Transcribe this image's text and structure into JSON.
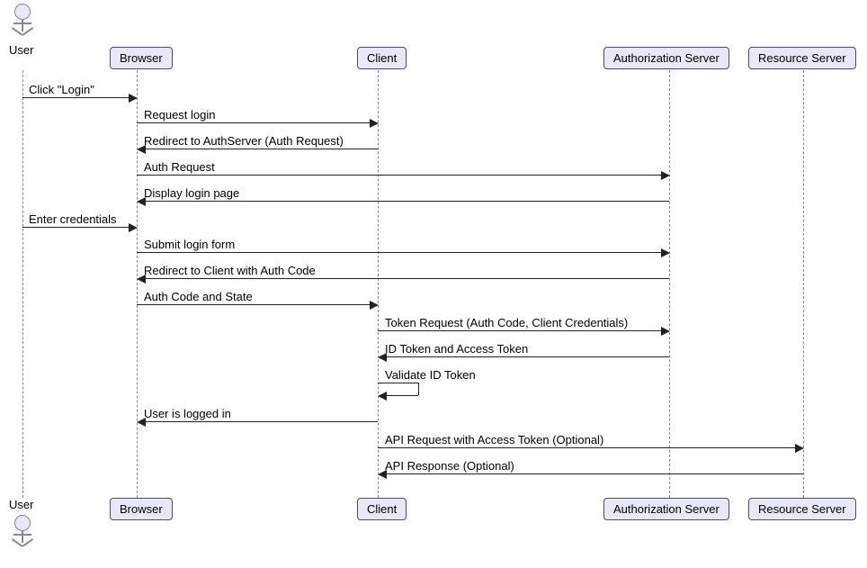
{
  "chart_data": {
    "type": "sequence-diagram",
    "participants": [
      {
        "id": "user",
        "name": "User",
        "kind": "actor"
      },
      {
        "id": "browser",
        "name": "Browser",
        "kind": "participant"
      },
      {
        "id": "client",
        "name": "Client",
        "kind": "participant"
      },
      {
        "id": "authserver",
        "name": "Authorization Server",
        "kind": "participant"
      },
      {
        "id": "resourceserver",
        "name": "Resource Server",
        "kind": "participant"
      }
    ],
    "messages": [
      {
        "from": "user",
        "to": "browser",
        "label": "Click \"Login\""
      },
      {
        "from": "browser",
        "to": "client",
        "label": "Request login"
      },
      {
        "from": "client",
        "to": "browser",
        "label": "Redirect to AuthServer (Auth Request)"
      },
      {
        "from": "browser",
        "to": "authserver",
        "label": "Auth Request"
      },
      {
        "from": "authserver",
        "to": "browser",
        "label": "Display login page"
      },
      {
        "from": "user",
        "to": "browser",
        "label": "Enter credentials"
      },
      {
        "from": "browser",
        "to": "authserver",
        "label": "Submit login form"
      },
      {
        "from": "authserver",
        "to": "browser",
        "label": "Redirect to Client with Auth Code"
      },
      {
        "from": "browser",
        "to": "client",
        "label": "Auth Code and State"
      },
      {
        "from": "client",
        "to": "authserver",
        "label": "Token Request (Auth Code, Client Credentials)"
      },
      {
        "from": "authserver",
        "to": "client",
        "label": "ID Token and Access Token"
      },
      {
        "from": "client",
        "to": "client",
        "label": "Validate ID Token"
      },
      {
        "from": "client",
        "to": "browser",
        "label": "User is logged in"
      },
      {
        "from": "client",
        "to": "resourceserver",
        "label": "API Request with Access Token (Optional)"
      },
      {
        "from": "resourceserver",
        "to": "client",
        "label": "API Response (Optional)"
      }
    ]
  },
  "participants": {
    "user": "User",
    "browser": "Browser",
    "client": "Client",
    "authserver": "Authorization Server",
    "resourceserver": "Resource Server"
  },
  "messages": {
    "m1": "Click \"Login\"",
    "m2": "Request login",
    "m3": "Redirect to AuthServer (Auth Request)",
    "m4": "Auth Request",
    "m5": "Display login page",
    "m6": "Enter credentials",
    "m7": "Submit login form",
    "m8": "Redirect to Client with Auth Code",
    "m9": "Auth Code and State",
    "m10": "Token Request (Auth Code, Client Credentials)",
    "m11": "ID Token and Access Token",
    "m12": "Validate ID Token",
    "m13": "User is logged in",
    "m14": "API Request with Access Token (Optional)",
    "m15": "API Response (Optional)"
  }
}
